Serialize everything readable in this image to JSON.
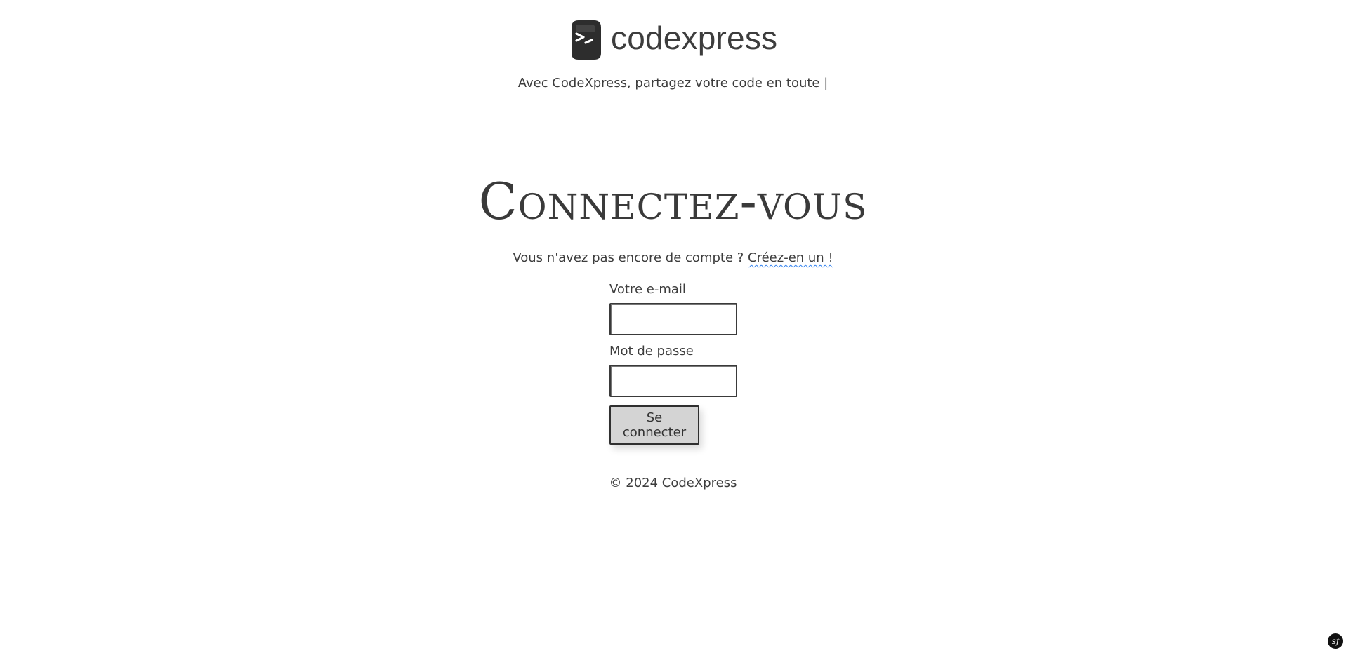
{
  "header": {
    "brand_name": "codexpress",
    "tagline": "Avec CodeXpress, partagez votre code en toute |"
  },
  "main": {
    "title": "Connectez-vous",
    "account_prompt": "Vous n'avez pas encore de compte ? ",
    "account_link": "Créez-en un !"
  },
  "form": {
    "email_label": "Votre e-mail",
    "email_value": "",
    "password_label": "Mot de passe",
    "password_value": "",
    "submit_label": "Se connecter"
  },
  "footer": {
    "text": "© 2024 CodeXpress"
  },
  "icons": {
    "logo": "terminal-prompt-icon",
    "symfony": "symfony-icon"
  },
  "colors": {
    "text": "#3d3d3d",
    "button_bg": "#d4d4d4",
    "link_underline": "#2f80ed",
    "background": "#ffffff"
  }
}
